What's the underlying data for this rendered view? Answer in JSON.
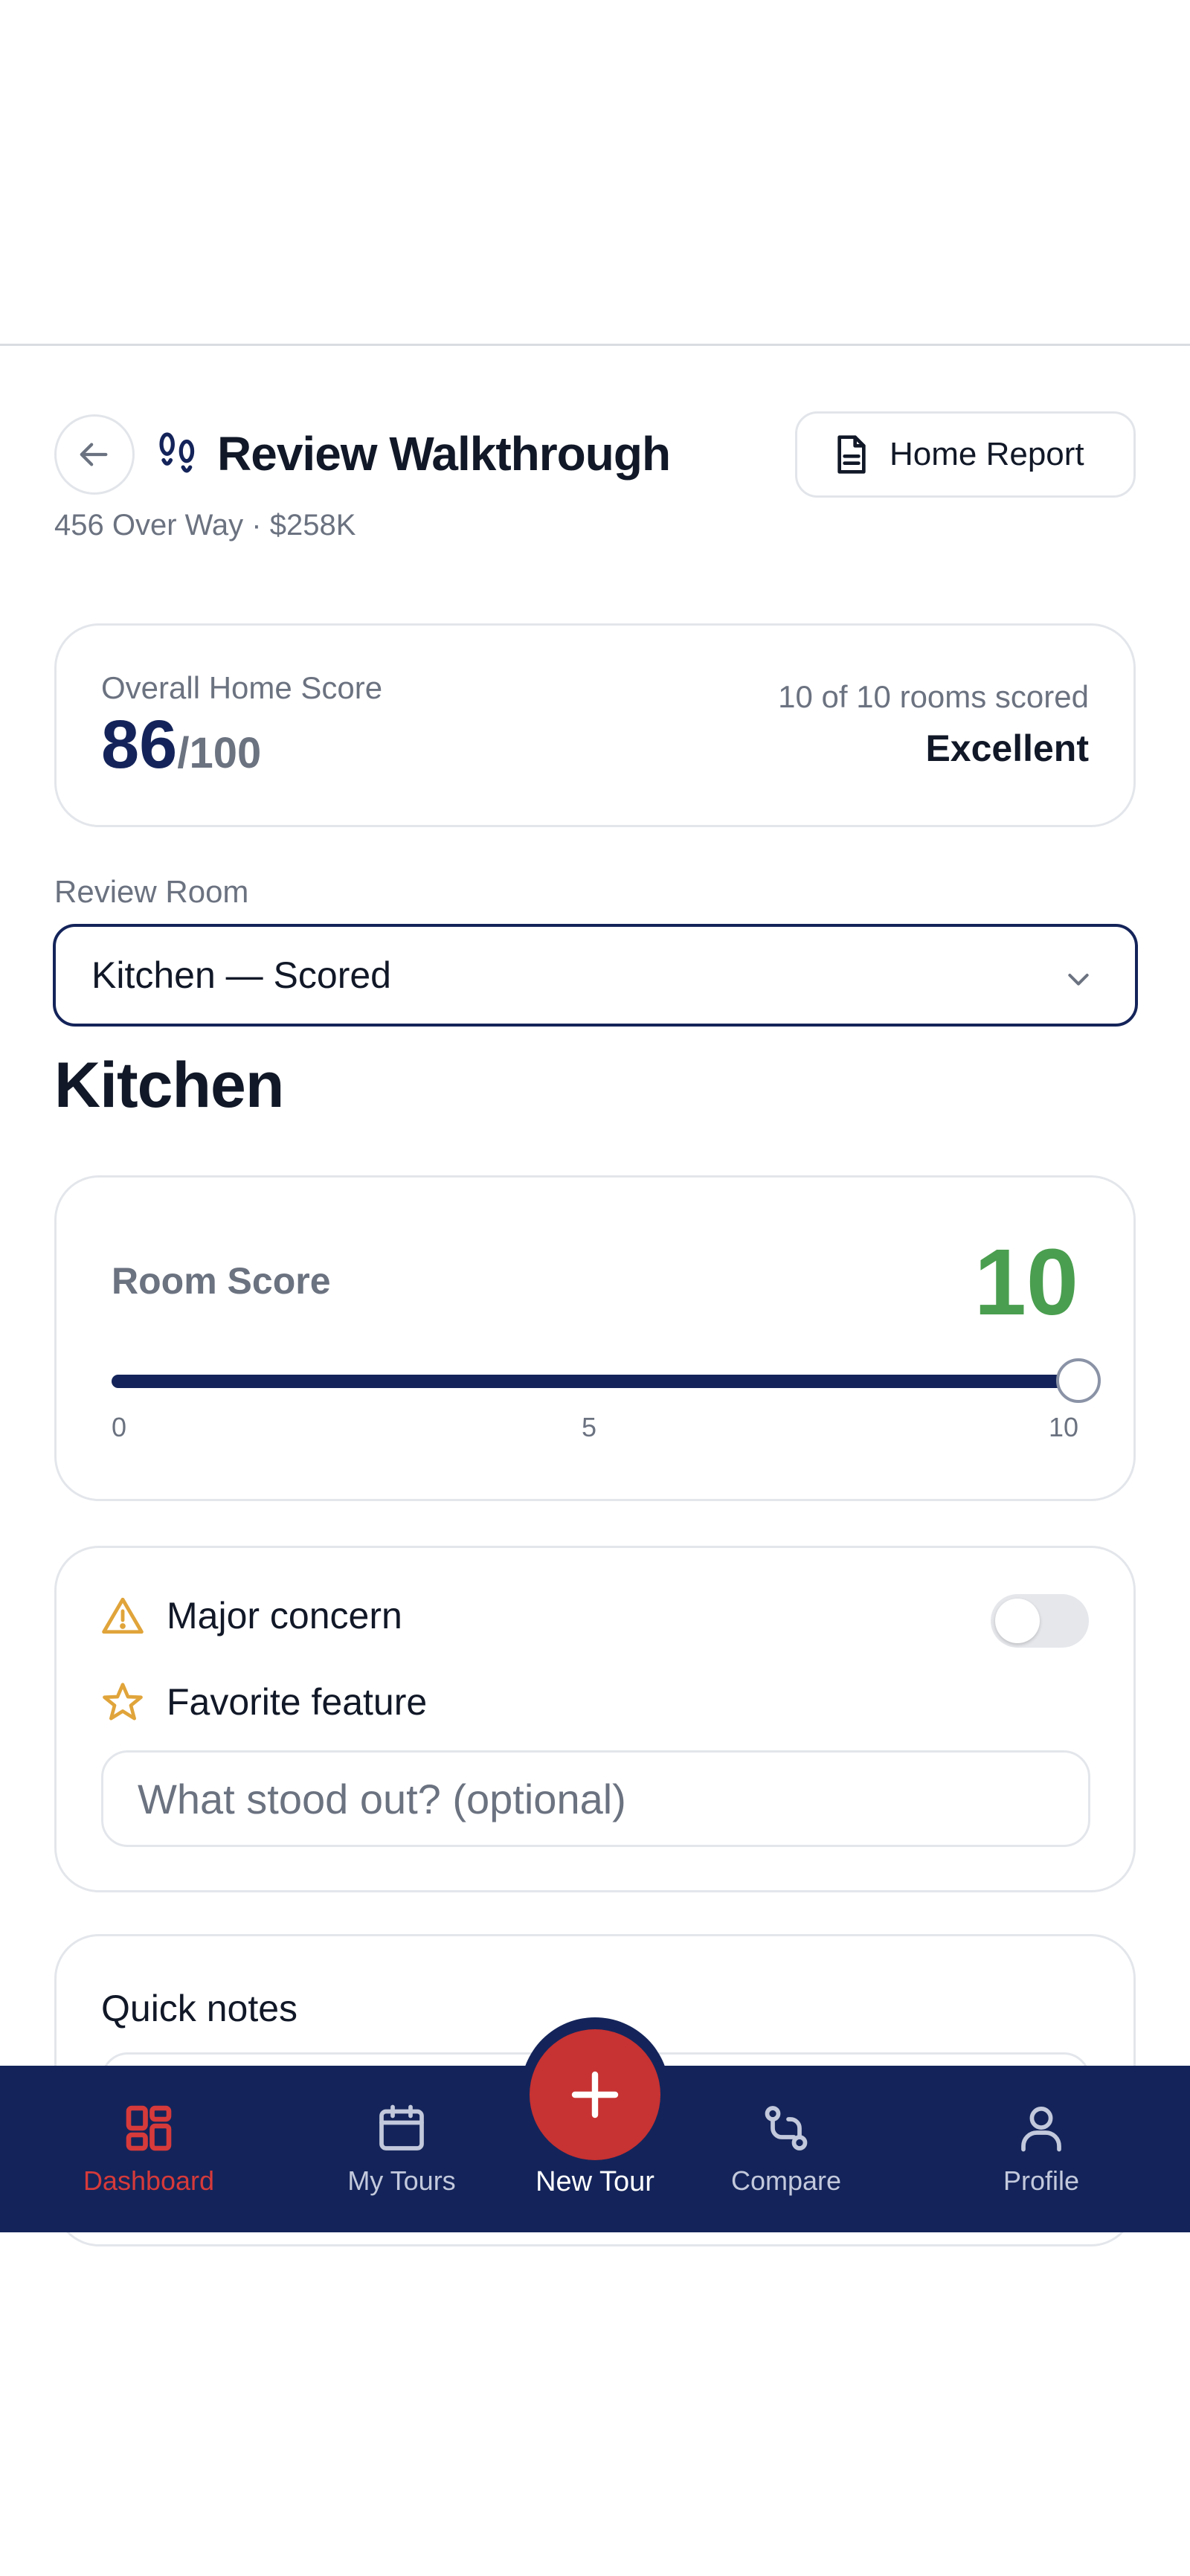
{
  "header": {
    "title": "Review Walkthrough",
    "title_icon": "footprints-icon",
    "back_icon": "arrow-left-icon",
    "subtitle": "456 Over Way · $258K",
    "report_button": {
      "label": "Home Report",
      "icon": "document-icon"
    }
  },
  "overall": {
    "label": "Overall Home Score",
    "score": "86",
    "out_of": "/100",
    "rooms_scored": "10 of 10 rooms scored",
    "rating": "Excellent"
  },
  "review_room": {
    "label": "Review Room",
    "selected": "Kitchen — Scored",
    "icon": "chevron-down-icon"
  },
  "room": {
    "heading": "Kitchen",
    "score_label": "Room Score",
    "score": "10",
    "slider": {
      "min": 0,
      "max": 10,
      "value": 10,
      "ticks": [
        "0",
        "5",
        "10"
      ]
    }
  },
  "flags": {
    "major_concern": {
      "label": "Major concern",
      "icon": "warning-icon",
      "enabled": false
    },
    "favorite_feature": {
      "label": "Favorite feature",
      "icon": "star-icon"
    },
    "favorite_placeholder": "What stood out? (optional)"
  },
  "notes": {
    "label": "Quick notes"
  },
  "nav": {
    "items": [
      {
        "label": "Dashboard",
        "icon": "dashboard-icon",
        "active": true
      },
      {
        "label": "My Tours",
        "icon": "calendar-icon",
        "active": false
      },
      {
        "label": "New Tour",
        "icon": "plus-icon",
        "active": false
      },
      {
        "label": "Compare",
        "icon": "compare-icon",
        "active": false
      },
      {
        "label": "Profile",
        "icon": "user-icon",
        "active": false
      }
    ]
  },
  "colors": {
    "primary": "#14245a",
    "accent_red": "#c73232",
    "score_green": "#4a9e4f",
    "warning": "#e0a43a"
  }
}
